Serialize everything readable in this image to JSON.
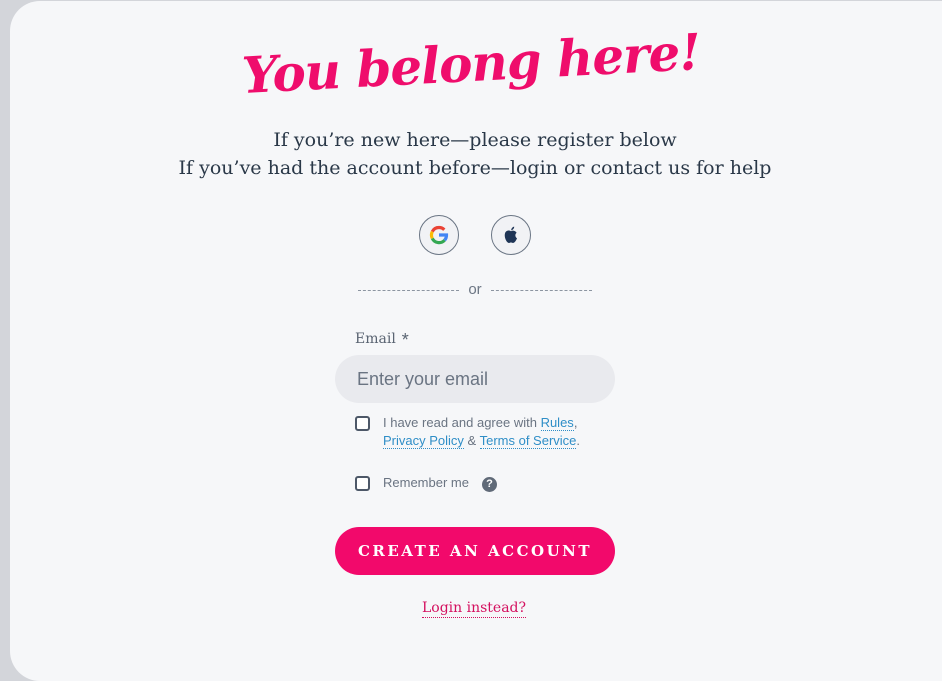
{
  "headline": "You belong here!",
  "intro": {
    "line1": "If you’re new here—please register below",
    "line2": "If you’ve had the account before—login or contact us for help"
  },
  "social": {
    "google_icon": "google-g-icon",
    "apple_icon": "apple-icon"
  },
  "divider_text": "or",
  "email": {
    "label": "Email",
    "required_mark": "*",
    "placeholder": "Enter your email",
    "value": ""
  },
  "agreement": {
    "prefix": "I have read and agree with ",
    "rules": "Rules",
    "comma": ",",
    "privacy": "Privacy Policy",
    "amp": " & ",
    "terms": "Terms of Service",
    "period": "."
  },
  "remember": {
    "label": "Remember me",
    "help_icon": "?"
  },
  "create_button": "CREATE AN ACCOUNT",
  "login_link": "Login instead?",
  "colors": {
    "accent": "#f2096b",
    "link": "#2f8ec7",
    "text": "#2a3848"
  }
}
